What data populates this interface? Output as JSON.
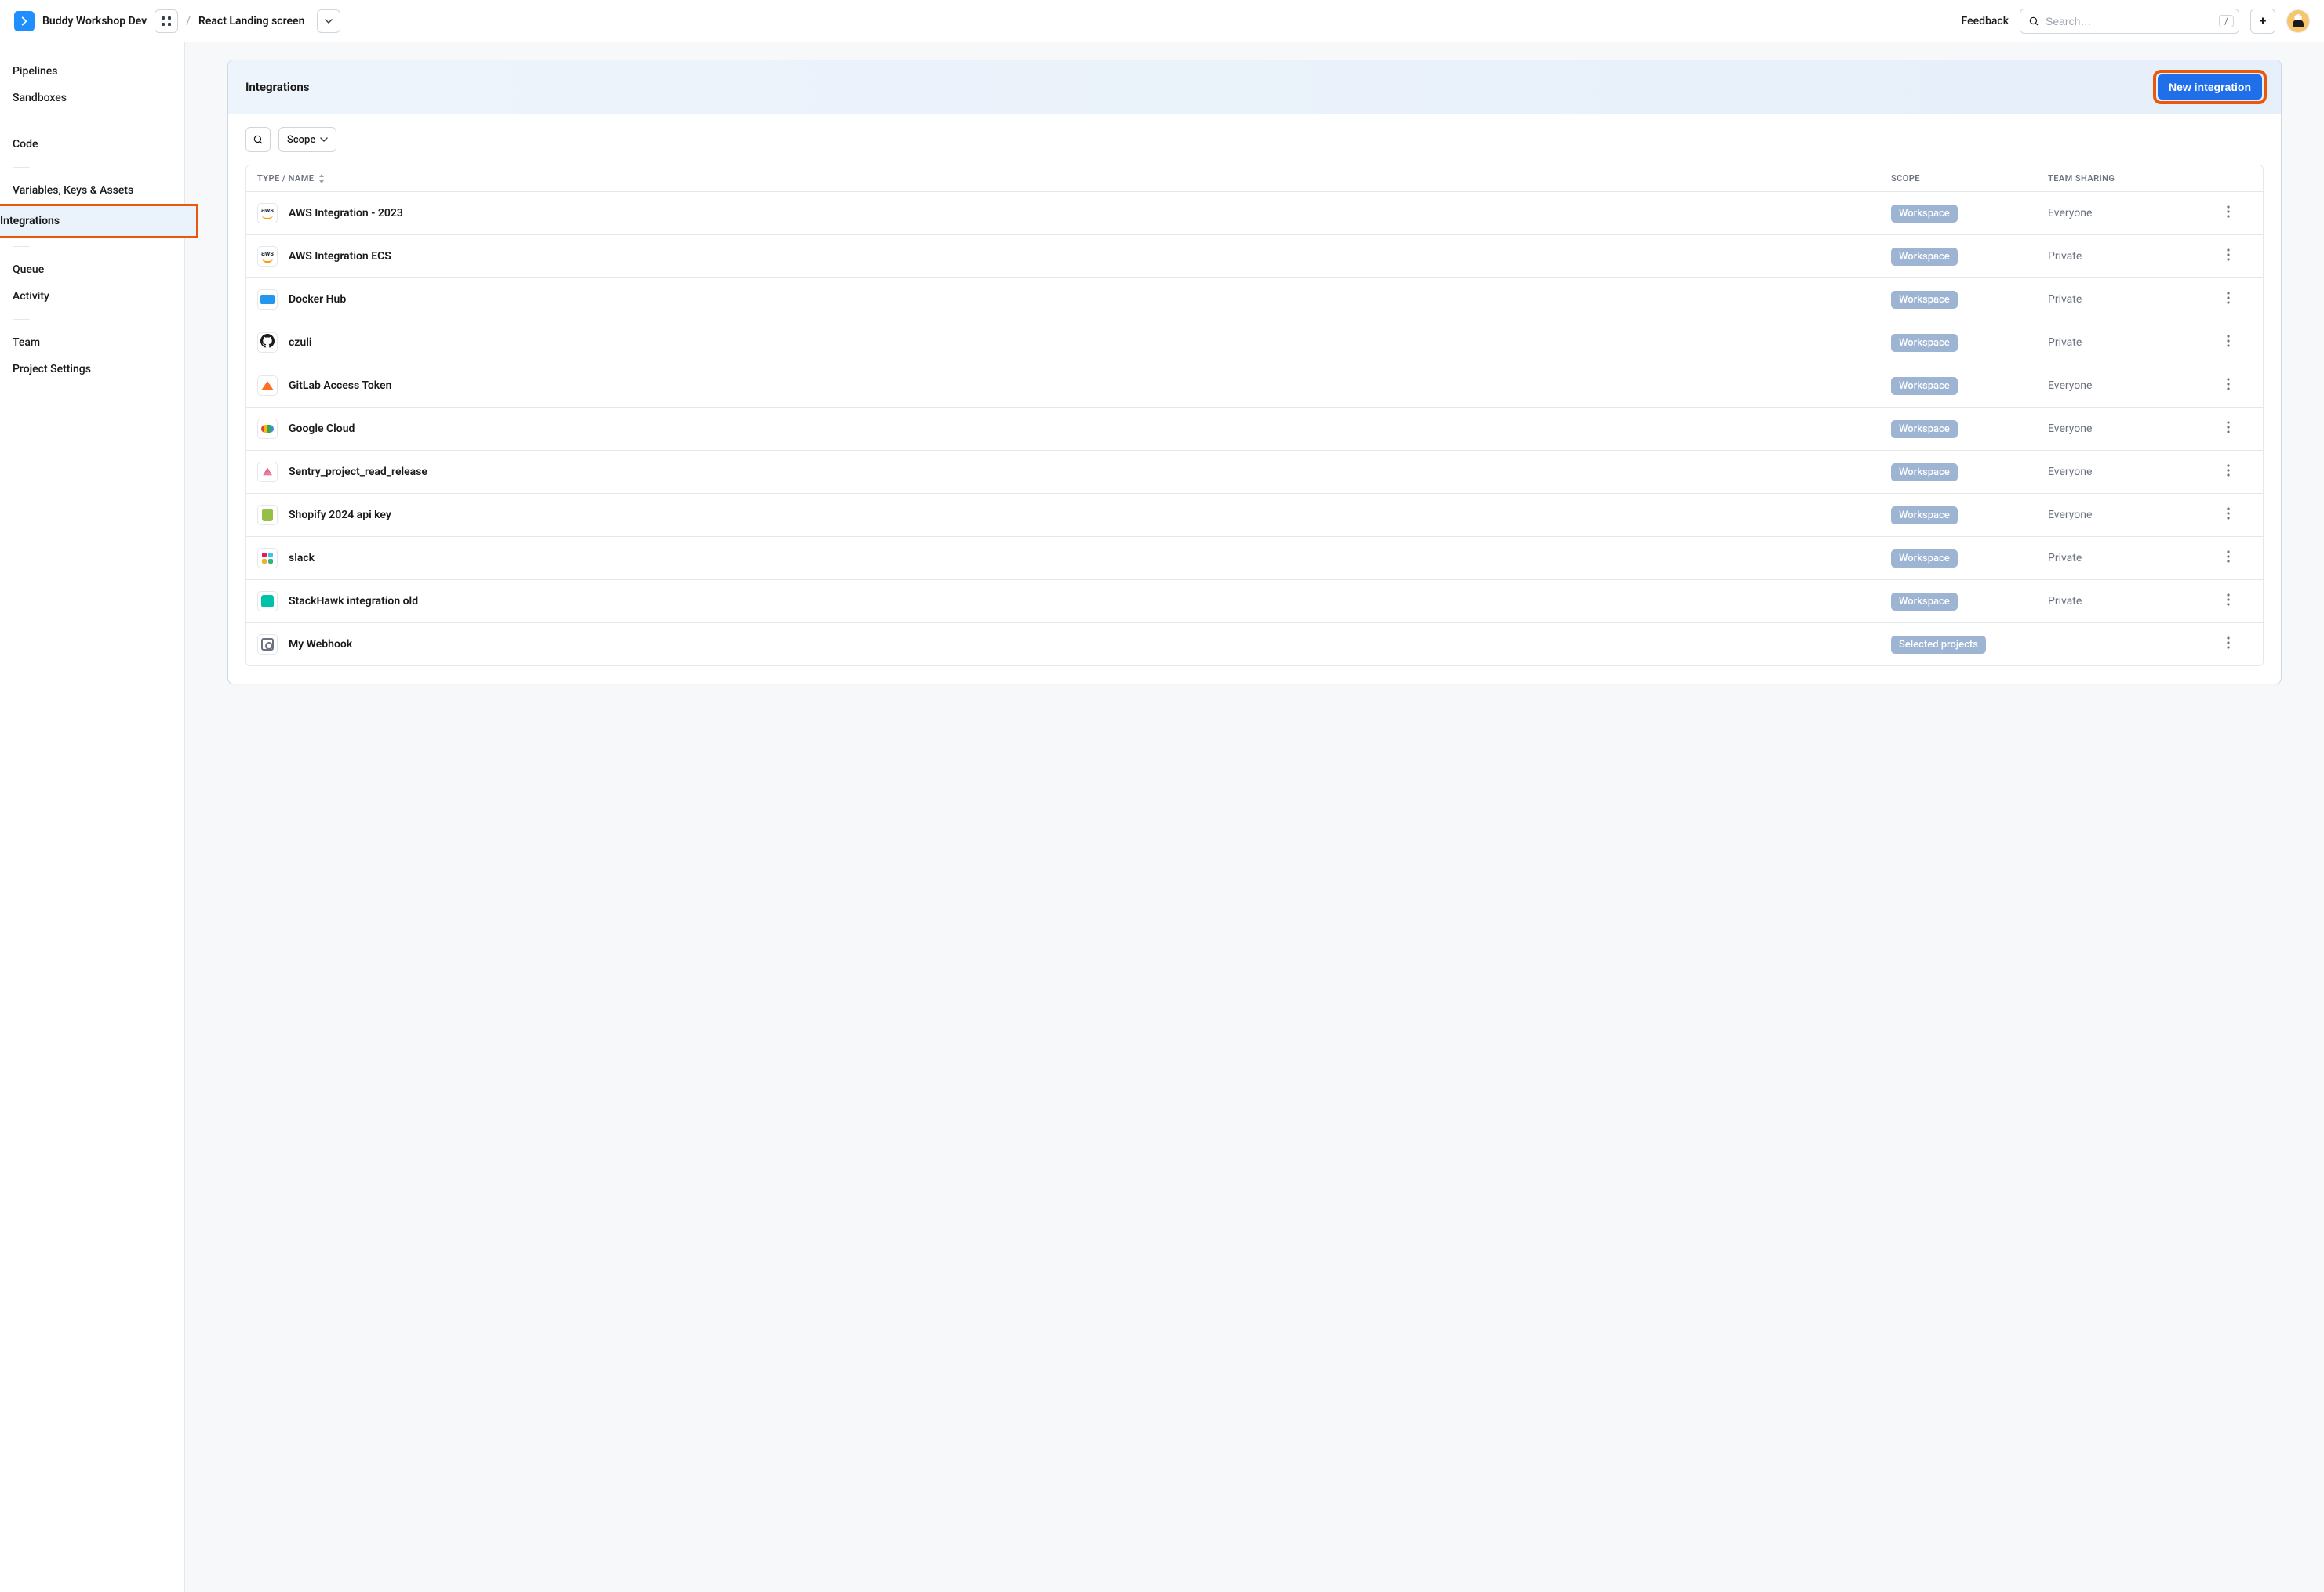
{
  "header": {
    "workspace_name": "Buddy Workshop Dev",
    "breadcrumb_sep": "/",
    "project_name": "React Landing screen",
    "feedback": "Feedback",
    "search_placeholder": "Search…",
    "search_kbd": "/"
  },
  "sidebar": {
    "pipelines": "Pipelines",
    "sandboxes": "Sandboxes",
    "code": "Code",
    "vars": "Variables, Keys & Assets",
    "integrations": "Integrations",
    "queue": "Queue",
    "activity": "Activity",
    "team": "Team",
    "settings": "Project Settings"
  },
  "panel": {
    "title": "Integrations",
    "new_button": "New integration",
    "scope_btn": "Scope",
    "col_type": "TYPE / NAME",
    "col_scope": "SCOPE",
    "col_sharing": "TEAM SHARING"
  },
  "rows": [
    {
      "icon": "aws",
      "name": "AWS Integration - 2023",
      "scope": "Workspace",
      "sharing": "Everyone"
    },
    {
      "icon": "aws",
      "name": "AWS Integration ECS",
      "scope": "Workspace",
      "sharing": "Private"
    },
    {
      "icon": "docker",
      "name": "Docker Hub",
      "scope": "Workspace",
      "sharing": "Private"
    },
    {
      "icon": "github",
      "name": "czuli",
      "scope": "Workspace",
      "sharing": "Private"
    },
    {
      "icon": "gitlab",
      "name": "GitLab Access Token",
      "scope": "Workspace",
      "sharing": "Everyone"
    },
    {
      "icon": "gcloud",
      "name": "Google Cloud",
      "scope": "Workspace",
      "sharing": "Everyone"
    },
    {
      "icon": "sentry",
      "name": "Sentry_project_read_release",
      "scope": "Workspace",
      "sharing": "Everyone"
    },
    {
      "icon": "shopify",
      "name": "Shopify 2024 api key",
      "scope": "Workspace",
      "sharing": "Everyone"
    },
    {
      "icon": "slack",
      "name": "slack",
      "scope": "Workspace",
      "sharing": "Private"
    },
    {
      "icon": "stackhawk",
      "name": "StackHawk integration old",
      "scope": "Workspace",
      "sharing": "Private"
    },
    {
      "icon": "webhook",
      "name": "My Webhook",
      "scope": "Selected projects",
      "sharing": ""
    }
  ]
}
